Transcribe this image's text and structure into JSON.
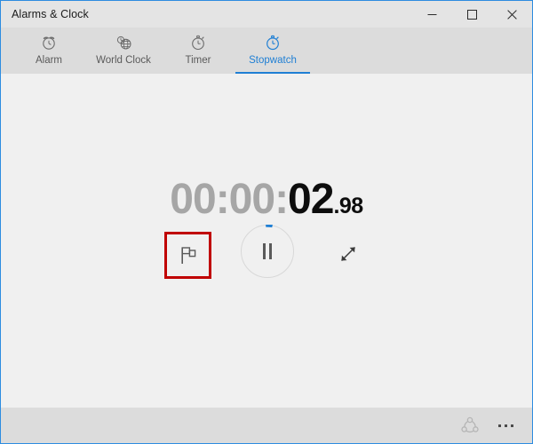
{
  "window": {
    "title": "Alarms & Clock",
    "accent_color": "#1f7fd4",
    "border_color": "#2d8ce0",
    "titlebar_bg": "#e4e4e4",
    "tabbar_bg": "#dcdcdc",
    "content_bg": "#f0f0f0",
    "controls": {
      "minimize_label": "Minimize",
      "maximize_label": "Maximize",
      "close_label": "Close"
    }
  },
  "tabs": [
    {
      "id": "alarm",
      "label": "Alarm",
      "icon": "alarm-clock-icon",
      "active": false
    },
    {
      "id": "world-clock",
      "label": "World Clock",
      "icon": "globe-clock-icon",
      "active": false
    },
    {
      "id": "timer",
      "label": "Timer",
      "icon": "timer-icon",
      "active": false
    },
    {
      "id": "stopwatch",
      "label": "Stopwatch",
      "icon": "stopwatch-icon",
      "active": true
    }
  ],
  "stopwatch": {
    "hours_minutes": "00:00:",
    "seconds": "02",
    "fraction": ".98",
    "full_time": "00:00:02.98",
    "state": "running",
    "lap_button": {
      "label": "Lap",
      "icon": "flag-icon",
      "highlighted": true,
      "highlight_color": "#c00000"
    },
    "pause_button": {
      "label": "Pause",
      "icon": "pause-icon",
      "progress_arc_color": "#1f7fd4",
      "ring_color": "#d8d8d8"
    },
    "expand_button": {
      "label": "Expand",
      "icon": "expand-arrow-icon"
    }
  },
  "bottombar": {
    "share": {
      "label": "Share",
      "icon": "share-icon"
    },
    "more": {
      "label": "See more",
      "icon": "ellipsis-icon"
    }
  }
}
